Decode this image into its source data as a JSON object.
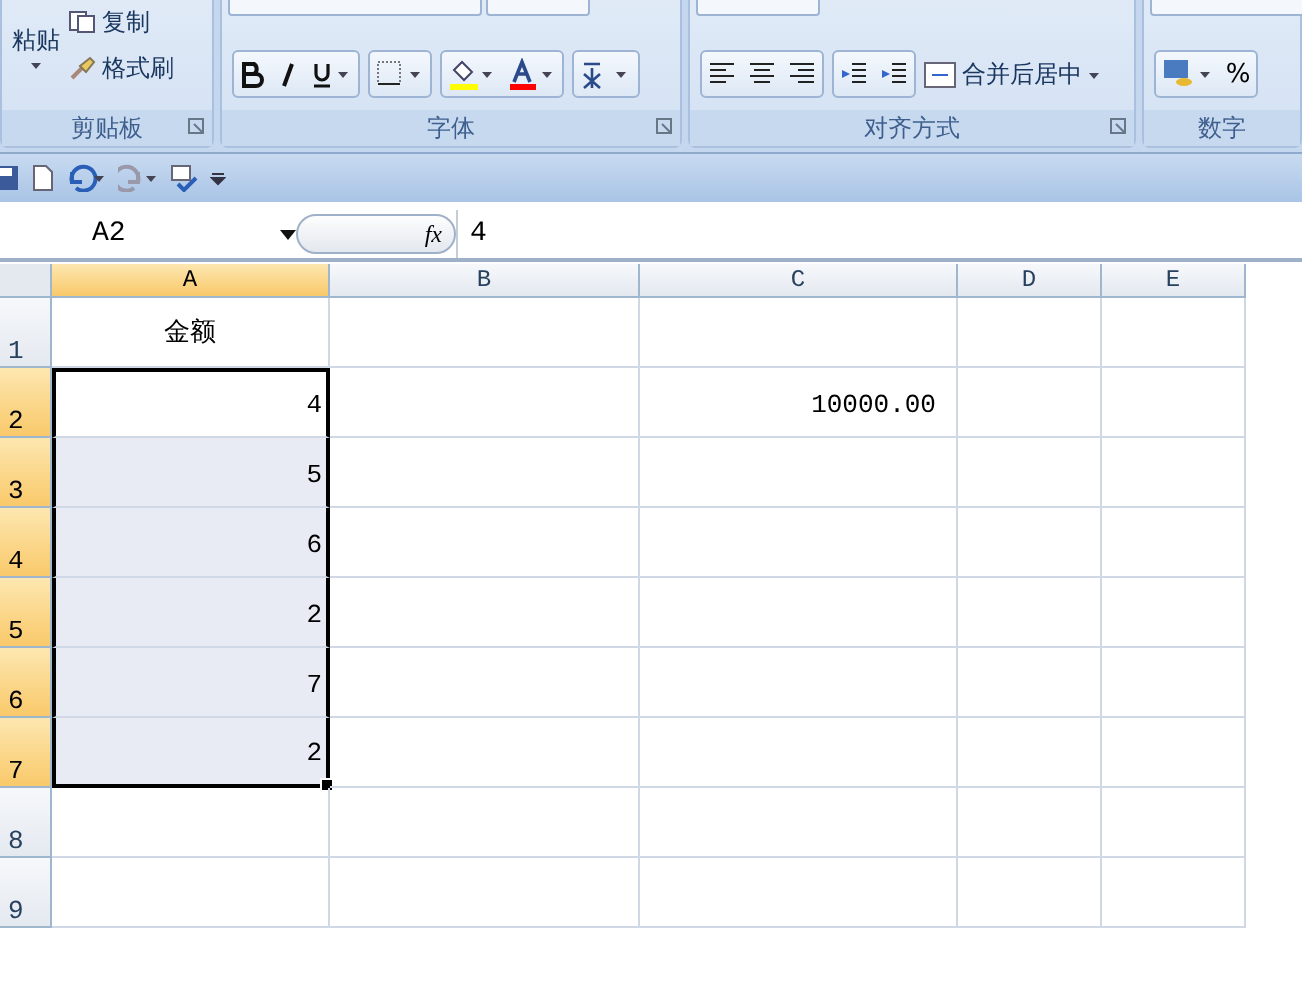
{
  "ribbon": {
    "groups": [
      {
        "kind": "clipboard",
        "label": "剪贴板",
        "paste": "粘贴",
        "copy": "复制",
        "format_painter": "格式刷"
      },
      {
        "kind": "font",
        "label": "字体"
      },
      {
        "kind": "alignment",
        "label": "对齐方式",
        "merge": "合并后居中"
      },
      {
        "kind": "number",
        "label": "数字",
        "percent": "%"
      }
    ]
  },
  "formula_bar": {
    "name_box": "A2",
    "fx": "fx",
    "value": "4"
  },
  "sheet": {
    "columns": [
      {
        "label": "A",
        "selected": true
      },
      {
        "label": "B",
        "selected": false
      },
      {
        "label": "C",
        "selected": false
      },
      {
        "label": "D",
        "selected": false
      },
      {
        "label": "E",
        "selected": false
      }
    ],
    "rows": [
      {
        "header": "1",
        "selected": false,
        "cells": [
          "金额",
          "",
          "",
          "",
          ""
        ]
      },
      {
        "header": "2",
        "selected": true,
        "cells": [
          "4",
          "",
          "10000.00",
          "",
          ""
        ]
      },
      {
        "header": "3",
        "selected": true,
        "cells": [
          "5",
          "",
          "",
          "",
          ""
        ]
      },
      {
        "header": "4",
        "selected": true,
        "cells": [
          "6",
          "",
          "",
          "",
          ""
        ]
      },
      {
        "header": "5",
        "selected": true,
        "cells": [
          "2",
          "",
          "",
          "",
          ""
        ]
      },
      {
        "header": "6",
        "selected": true,
        "cells": [
          "7",
          "",
          "",
          "",
          ""
        ]
      },
      {
        "header": "7",
        "selected": true,
        "cells": [
          "2",
          "",
          "",
          "",
          ""
        ]
      },
      {
        "header": "8",
        "selected": false,
        "cells": [
          "",
          "",
          "",
          "",
          ""
        ]
      },
      {
        "header": "9",
        "selected": false,
        "cells": [
          "",
          "",
          "",
          "",
          ""
        ]
      }
    ]
  }
}
